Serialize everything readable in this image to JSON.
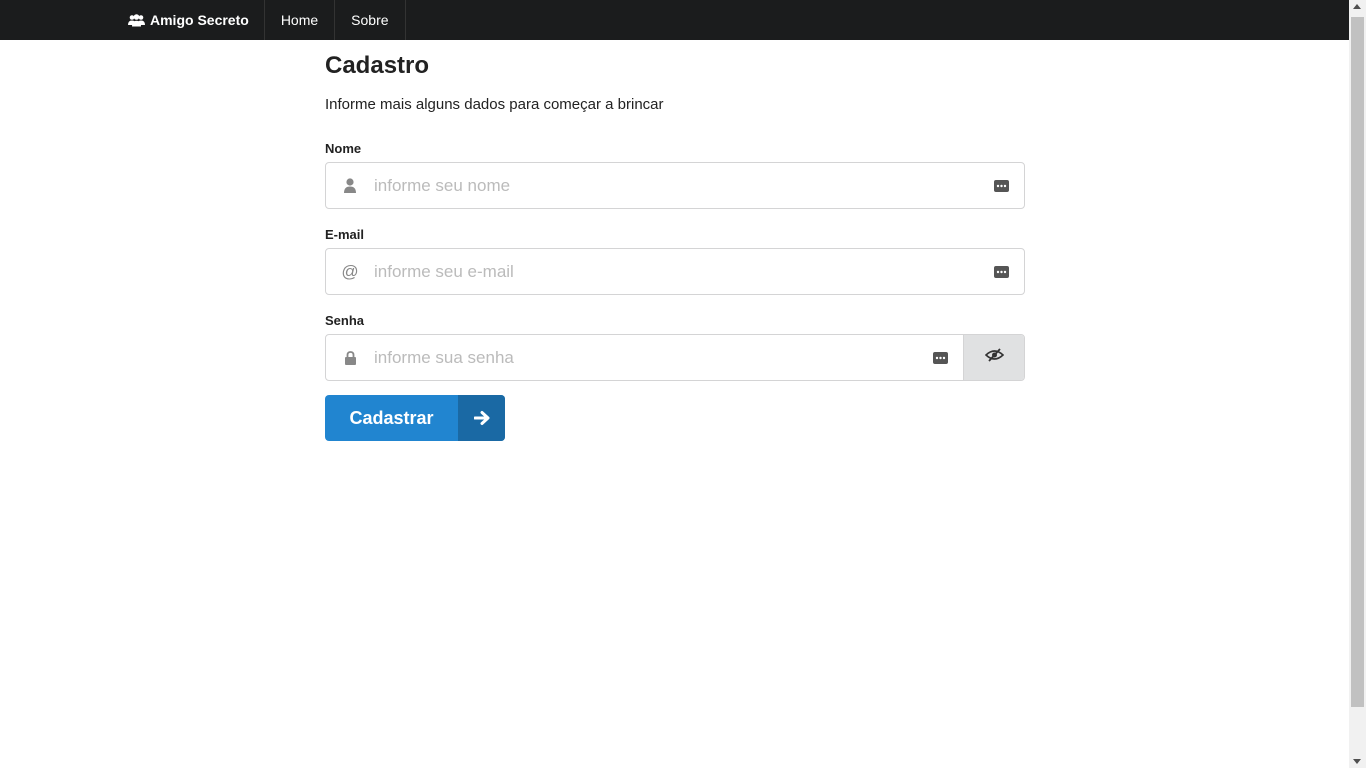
{
  "navbar": {
    "brand_label": "Amigo Secreto",
    "brand_icon": "users-icon",
    "items": [
      {
        "label": "Home"
      },
      {
        "label": "Sobre"
      }
    ]
  },
  "page": {
    "title": "Cadastro",
    "subtitle": "Informe mais alguns dados para começar a brincar"
  },
  "form": {
    "name": {
      "label": "Nome",
      "placeholder": "informe seu nome",
      "value": "",
      "icon": "user-icon"
    },
    "email": {
      "label": "E-mail",
      "placeholder": "informe seu e-mail",
      "value": "",
      "icon": "at-icon"
    },
    "password": {
      "label": "Senha",
      "placeholder": "informe sua senha",
      "value": "",
      "icon": "lock-icon",
      "toggle_icon": "eye-slash-icon"
    },
    "submit_label": "Cadastrar",
    "submit_icon": "arrow-right-icon"
  },
  "colors": {
    "navbar_bg": "#1b1c1d",
    "primary": "#2185d0",
    "primary_dark": "#1a69a4"
  }
}
